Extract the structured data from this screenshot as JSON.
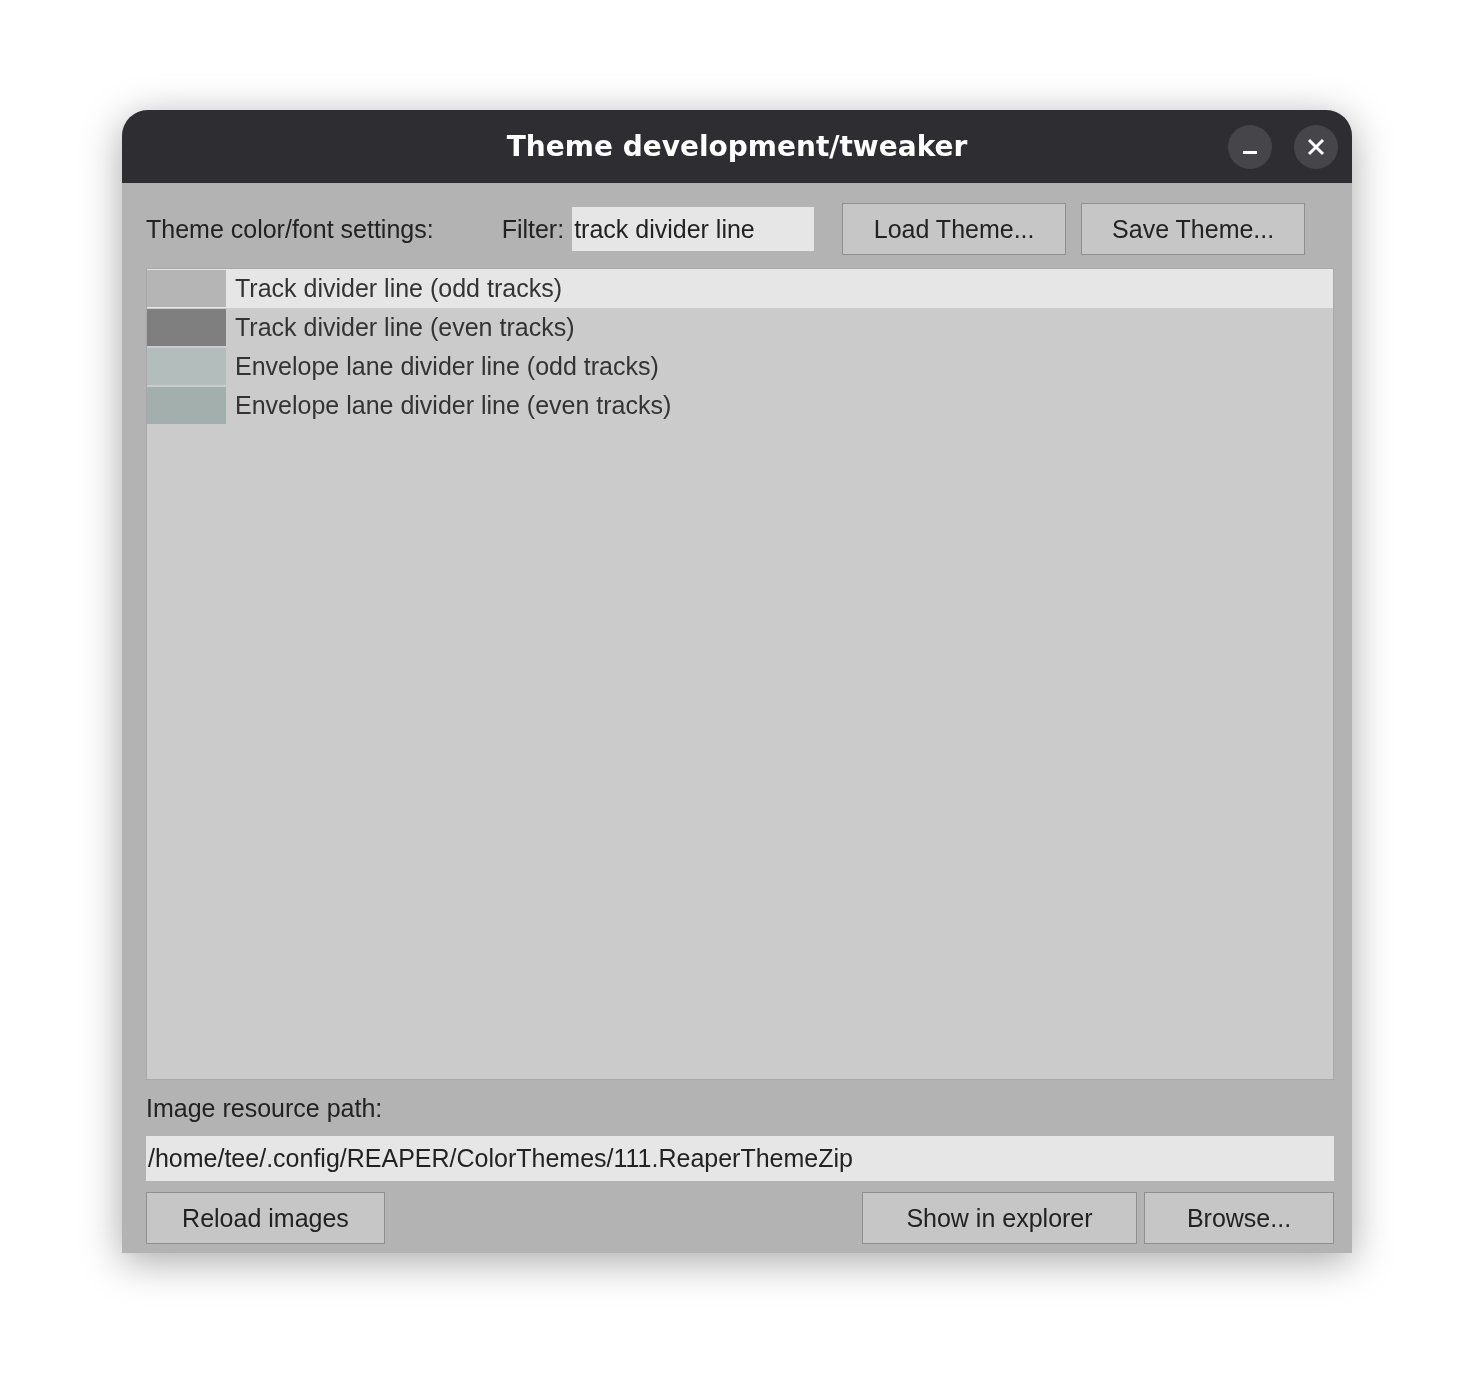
{
  "window": {
    "title": "Theme development/tweaker"
  },
  "toolbar": {
    "label": "Theme color/font settings:",
    "filter_label": "Filter:",
    "filter_value": "track divider line",
    "buttons": [
      "Load Theme...",
      "Save Theme..."
    ]
  },
  "items": [
    {
      "name": "Track divider line (odd tracks)",
      "color": "#b5b5b5",
      "selected": true
    },
    {
      "name": "Track divider line (even tracks)",
      "color": "#7f7f7f",
      "selected": false
    },
    {
      "name": "Envelope lane divider line (odd tracks)",
      "color": "#b3bdbb",
      "selected": false
    },
    {
      "name": "Envelope lane divider line (even tracks)",
      "color": "#a3afad",
      "selected": false
    }
  ],
  "resource": {
    "label": "Image resource path:",
    "path": "/home/tee/.config/REAPER/ColorThemes/111.ReaperThemeZip"
  },
  "bottom_buttons": {
    "left": "Reload images",
    "right": [
      "Show in explorer",
      "Browse..."
    ]
  }
}
